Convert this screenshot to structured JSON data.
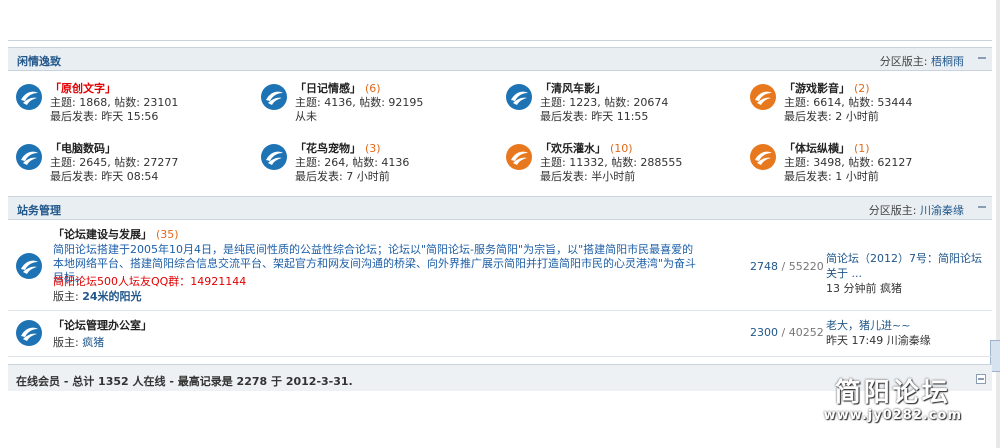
{
  "categories": [
    {
      "title": "闲情逸致",
      "moderator_label": "分区版主:",
      "moderator": "梧桐雨",
      "forums": [
        {
          "name": "「原创文字」",
          "name_red": true,
          "today": "",
          "line1": "主题: 1868, 帖数: 23101",
          "line2": "最后发表: 昨天 15:56",
          "icon": "blue"
        },
        {
          "name": "「日记情感」",
          "name_red": false,
          "today": "(6)",
          "line1": "主题: 4136, 帖数: 92195",
          "line2": "从未",
          "icon": "blue"
        },
        {
          "name": "「清风车影」",
          "name_red": false,
          "today": "",
          "line1": "主题: 1223, 帖数: 20674",
          "line2": "最后发表: 昨天 11:55",
          "icon": "blue"
        },
        {
          "name": "「游戏影音」",
          "name_red": false,
          "today": "(2)",
          "line1": "主题: 6614, 帖数: 53444",
          "line2": "最后发表: 2 小时前",
          "icon": "orange"
        },
        {
          "name": "「电脑数码」",
          "name_red": false,
          "today": "",
          "line1": "主题: 2645, 帖数: 27277",
          "line2": "最后发表: 昨天 08:54",
          "icon": "blue"
        },
        {
          "name": "「花鸟宠物」",
          "name_red": false,
          "today": "(3)",
          "line1": "主题: 264, 帖数: 4136",
          "line2": "最后发表: 7 小时前",
          "icon": "blue"
        },
        {
          "name": "「欢乐灌水」",
          "name_red": false,
          "today": "(10)",
          "line1": "主题: 11332, 帖数: 288555",
          "line2": "最后发表: 半小时前",
          "icon": "orange"
        },
        {
          "name": "「体坛纵横」",
          "name_red": false,
          "today": "(1)",
          "line1": "主题: 3498, 帖数: 62127",
          "line2": "最后发表: 1 小时前",
          "icon": "orange"
        }
      ]
    },
    {
      "title": "站务管理",
      "moderator_label": "分区版主:",
      "moderator": "川渝秦缘",
      "rows": [
        {
          "name": "「论坛建设与发展」",
          "today": "(35)",
          "desc": "简阳论坛搭建于2005年10月4日，是纯民间性质的公益性综合论坛；论坛以\"简阳论坛-服务简阳\"为宗旨，以\"搭建简阳市民最喜爱的本地网络平台、搭建简阳综合信息交流平台、架起官方和网友间沟通的桥梁、向外界推广展示简阳并打造简阳市民的心灵港湾\"为奋斗目标。",
          "qq": "简阳论坛500人坛友QQ群：14921144",
          "mod_label": "版主:",
          "mod": "24米的阳光",
          "threads": "2748",
          "posts": "55220",
          "last_title": "简论坛（2012）7号：简阳论坛关于 ...",
          "last_meta": "13 分钟前 疯猪"
        },
        {
          "name": "「论坛管理办公室」",
          "today": "",
          "desc": "",
          "qq": "",
          "mod_label": "版主:",
          "mod": "疯猪",
          "threads": "2300",
          "posts": "40252",
          "last_title": "老大，猪儿进~~",
          "last_meta": "昨天 17:49 川渝秦缘"
        }
      ]
    }
  ],
  "online": {
    "text": "在线会员 - 总计 1352 人在线 - 最高记录是 2278 于 2012-3-31."
  },
  "watermark": {
    "title": "简阳论坛",
    "url": "www.jy0282.com"
  },
  "colors": {
    "icon_blue": "#1e73b5",
    "icon_orange": "#e8781e",
    "link": "#21578a",
    "red": "#e00000"
  }
}
